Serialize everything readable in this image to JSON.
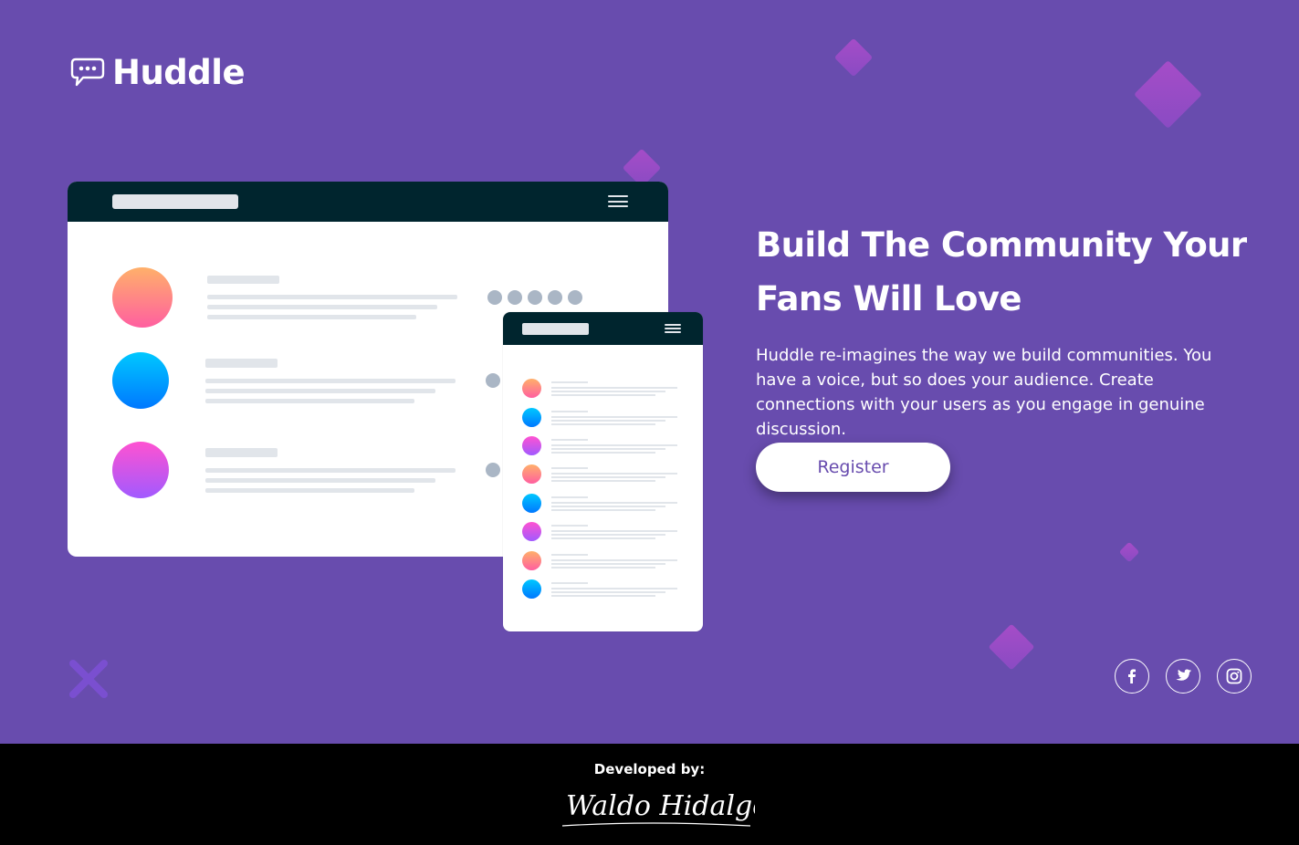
{
  "brand": {
    "name": "Huddle",
    "icon": "chat-bubble-icon"
  },
  "hero": {
    "headline": "Build The Community Your Fans Will Love",
    "description": "Huddle re-imagines the way we build communities. You have a voice, but so does your audience. Create connections with your users as you engage in genuine discussion.",
    "cta_label": "Register"
  },
  "social": [
    {
      "name": "facebook-icon",
      "glyph": "f"
    },
    {
      "name": "twitter-icon"
    },
    {
      "name": "instagram-icon"
    }
  ],
  "footer": {
    "developed_by": "Developed by:",
    "signature": "Waldo Hidalgo"
  },
  "colors": {
    "background": "#684cae",
    "footer": "#000000",
    "mock_bar": "#00252e",
    "accent_diamond": "#a94cc9"
  }
}
